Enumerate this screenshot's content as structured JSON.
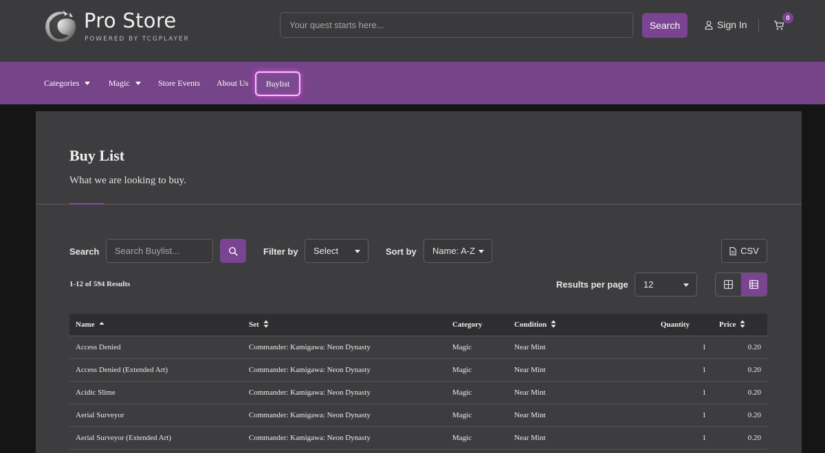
{
  "header": {
    "logo_title": "Pro Store",
    "logo_subtitle": "POWERED BY TCGPLAYER",
    "search_placeholder": "Your quest starts here...",
    "search_button": "Search",
    "sign_in": "Sign In",
    "cart_count": "0"
  },
  "nav": {
    "items": [
      {
        "label": "Categories",
        "has_caret": true
      },
      {
        "label": "Magic",
        "has_caret": true
      },
      {
        "label": "Store Events",
        "has_caret": false
      },
      {
        "label": "About Us",
        "has_caret": false
      },
      {
        "label": "Buylist",
        "has_caret": false,
        "active": true
      }
    ]
  },
  "page": {
    "title": "Buy List",
    "subtitle": "What we are looking to buy."
  },
  "controls": {
    "search_label": "Search",
    "search_placeholder": "Search Buylist...",
    "filter_label": "Filter by",
    "filter_value": "Select",
    "sort_label": "Sort by",
    "sort_value": "Name: A-Z",
    "csv_label": "CSV",
    "results_text": "1-12 of 594 Results",
    "per_page_label": "Results per page",
    "per_page_value": "12"
  },
  "table": {
    "columns": [
      "Name",
      "Set",
      "Category",
      "Condition",
      "Quantity",
      "Price"
    ],
    "rows": [
      [
        "Access Denied",
        "Commander: Kamigawa: Neon Dynasty",
        "Magic",
        "Near Mint",
        "1",
        "0.20"
      ],
      [
        "Access Denied (Extended Art)",
        "Commander: Kamigawa: Neon Dynasty",
        "Magic",
        "Near Mint",
        "1",
        "0.20"
      ],
      [
        "Acidic Slime",
        "Commander: Kamigawa: Neon Dynasty",
        "Magic",
        "Near Mint",
        "1",
        "0.20"
      ],
      [
        "Aerial Surveyor",
        "Commander: Kamigawa: Neon Dynasty",
        "Magic",
        "Near Mint",
        "1",
        "0.20"
      ],
      [
        "Aerial Surveyor (Extended Art)",
        "Commander: Kamigawa: Neon Dynasty",
        "Magic",
        "Near Mint",
        "1",
        "0.20"
      ]
    ]
  },
  "icons": {
    "logo": "dragon-logo-icon",
    "user": "user-icon",
    "cart": "cart-icon",
    "search": "search-icon",
    "csv": "file-icon",
    "grid_view": "grid-view-icon",
    "list_view": "list-view-icon"
  },
  "colors": {
    "accent": "#7b4493",
    "nav_bg": "#754489",
    "header_bg": "#3b3a3c",
    "panel_bg": "#3d3c3e"
  }
}
